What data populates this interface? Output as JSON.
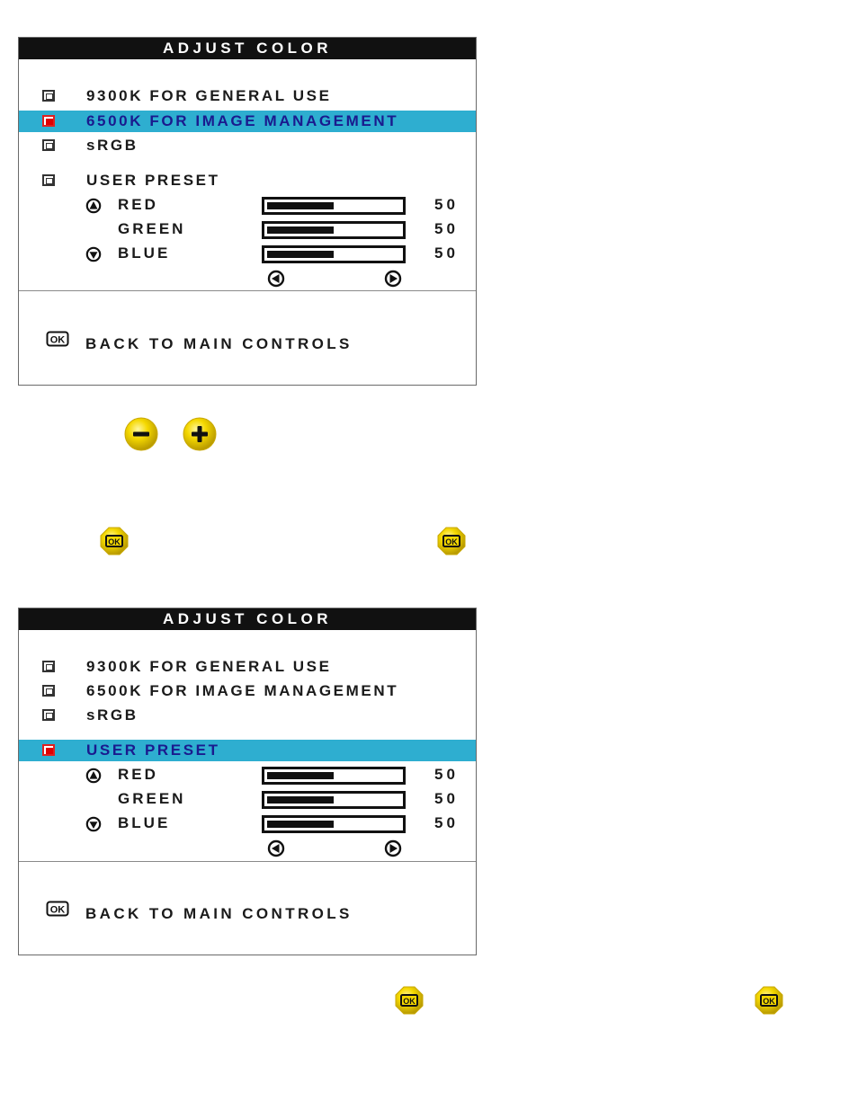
{
  "colors": {
    "title_bar": "#111111",
    "highlight": "#2eaed0",
    "highlight_text": "#1a1a8e",
    "selected_checkbox": "#e00000",
    "button_yellow": "#f2d200"
  },
  "panels": [
    {
      "title": "ADJUST COLOR",
      "options": [
        {
          "label": "9300K FOR GENERAL USE",
          "selected": false,
          "highlighted": false
        },
        {
          "label": "6500K FOR IMAGE MANAGEMENT",
          "selected": true,
          "highlighted": true
        },
        {
          "label": "sRGB",
          "selected": false,
          "highlighted": false
        },
        {
          "label": "USER PRESET",
          "selected": false,
          "highlighted": false
        }
      ],
      "user_preset": [
        {
          "label": "RED",
          "value": "50",
          "percent": 50,
          "icon": "up-arrow-circle-icon"
        },
        {
          "label": "GREEN",
          "value": "50",
          "percent": 50,
          "icon": ""
        },
        {
          "label": "BLUE",
          "value": "50",
          "percent": 50,
          "icon": "down-arrow-circle-icon"
        }
      ],
      "adjust_icons": [
        "left-arrow-circle-icon",
        "right-arrow-circle-icon"
      ],
      "back": {
        "label": "BACK TO MAIN CONTROLS",
        "icon": "ok-icon"
      }
    },
    {
      "title": "ADJUST COLOR",
      "options": [
        {
          "label": "9300K FOR GENERAL USE",
          "selected": false,
          "highlighted": false
        },
        {
          "label": "6500K FOR IMAGE MANAGEMENT",
          "selected": false,
          "highlighted": false
        },
        {
          "label": "sRGB",
          "selected": false,
          "highlighted": false
        },
        {
          "label": "USER PRESET",
          "selected": true,
          "highlighted": true
        }
      ],
      "user_preset": [
        {
          "label": "RED",
          "value": "50",
          "percent": 50,
          "icon": "up-arrow-circle-icon"
        },
        {
          "label": "GREEN",
          "value": "50",
          "percent": 50,
          "icon": ""
        },
        {
          "label": "BLUE",
          "value": "50",
          "percent": 50,
          "icon": "down-arrow-circle-icon"
        }
      ],
      "adjust_icons": [
        "left-arrow-circle-icon",
        "right-arrow-circle-icon"
      ],
      "back": {
        "label": "BACK TO MAIN CONTROLS",
        "icon": "ok-icon"
      }
    }
  ],
  "buttons": {
    "minus": {
      "icon": "minus-button-icon"
    },
    "plus": {
      "icon": "plus-button-icon"
    },
    "ok": {
      "icon": "ok-button-icon"
    }
  }
}
